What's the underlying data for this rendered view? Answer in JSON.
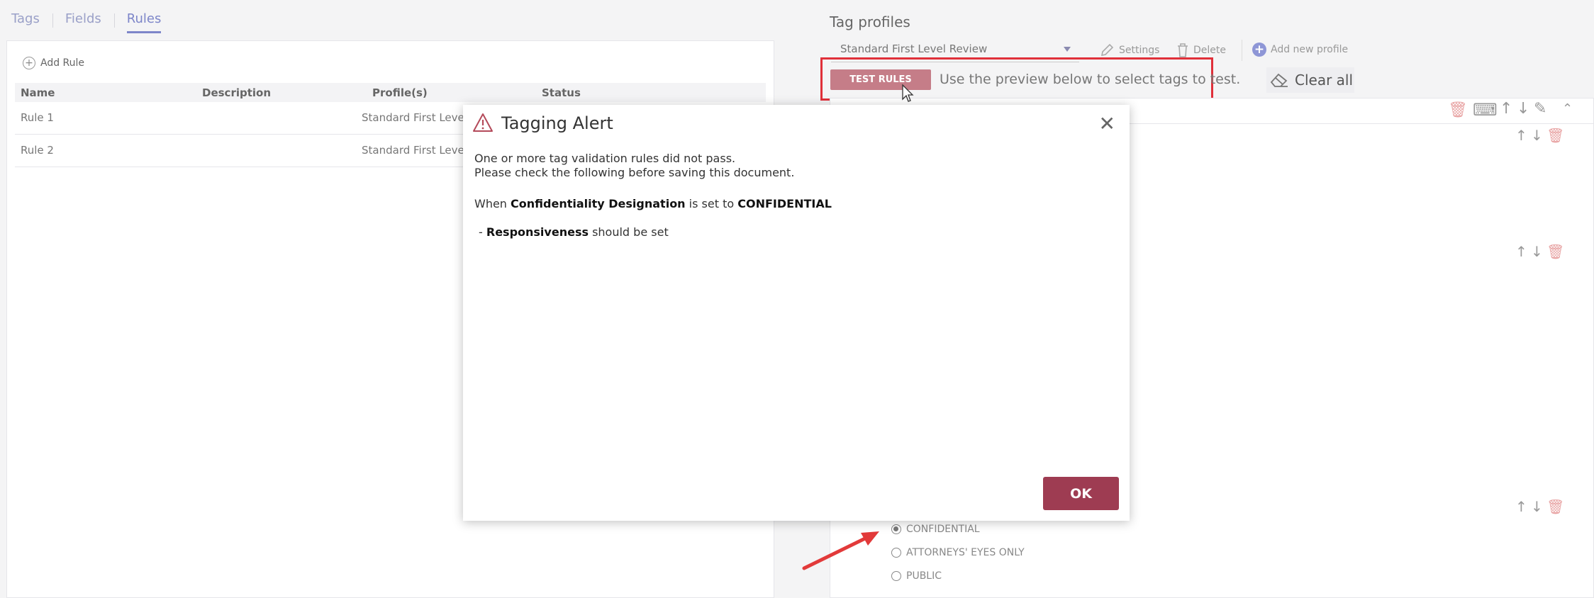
{
  "tabs": [
    {
      "label": "Tags",
      "active": false
    },
    {
      "label": "Fields",
      "active": false
    },
    {
      "label": "Rules",
      "active": true
    }
  ],
  "rules_panel": {
    "add_rule_label": "Add Rule",
    "columns": [
      "Name",
      "Description",
      "Profile(s)",
      "Status"
    ],
    "rows": [
      {
        "name": "Rule 1",
        "description": "",
        "profiles": "Standard First Level I",
        "status": ""
      },
      {
        "name": "Rule 2",
        "description": "",
        "profiles": "Standard First Level I",
        "status": ""
      }
    ]
  },
  "tag_profiles": {
    "title": "Tag profiles",
    "selected_profile": "Standard First Level Review",
    "settings_label": "Settings",
    "delete_label": "Delete",
    "add_profile_label": "Add new profile",
    "test_rules_label": "TEST RULES",
    "test_hint": "Use the preview below to select tags to test.",
    "clear_all_label": "Clear all",
    "radio_options": [
      {
        "label": "CONFIDENTIAL",
        "checked": true
      },
      {
        "label": "ATTORNEYS' EYES ONLY",
        "checked": false
      },
      {
        "label": "PUBLIC",
        "checked": false
      }
    ]
  },
  "modal": {
    "title": "Tagging Alert",
    "line1": "One or more tag validation rules did not pass.",
    "line2": "Please check the following before saving this document.",
    "when_prefix": "When",
    "field_name": "Confidentiality Designation",
    "is_set_to": "is set to",
    "field_value": "CONFIDENTIAL",
    "requirement_prefix": "-",
    "requirement_field": "Responsiveness",
    "requirement_suffix": "should be set",
    "ok_label": "OK"
  },
  "colors": {
    "accent_tab": "#7d86c9",
    "test_rules_bg": "#c57d88",
    "ok_bg": "#9e3c52",
    "highlight": "#e0303a",
    "annotation_arrow": "#e23a3a"
  }
}
